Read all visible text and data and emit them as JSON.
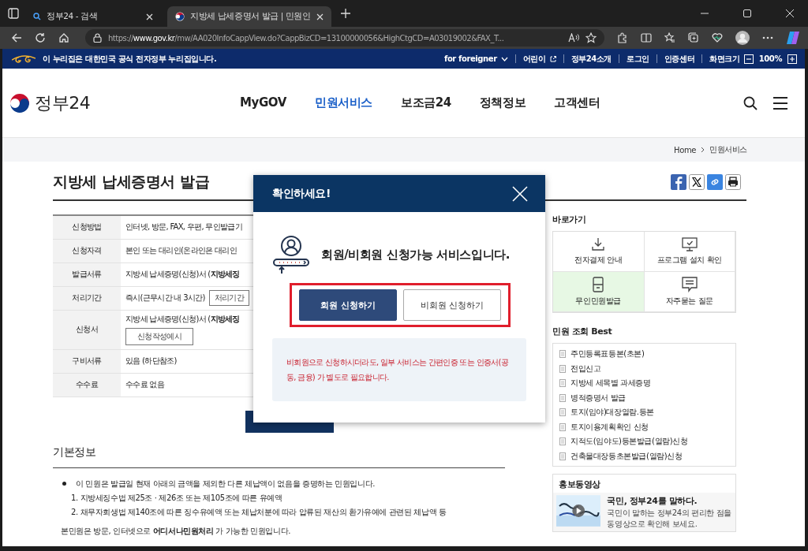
{
  "browser": {
    "tabs": [
      {
        "title": "정부24 - 검색",
        "selected": false
      },
      {
        "title": "지방세 납세증명서 발급 | 민원인",
        "selected": true
      }
    ],
    "url": "https://**www.gov.kr**/mw/AA020InfoCappView.do?CappBizCD=13100000056&HighCtgCD=A03019002&FAX_T..."
  },
  "banner": {
    "notice": "이 누리집은 대한민국 공식 전자정부 누리집입니다.",
    "links": [
      {
        "label": "for foreigner",
        "kind": "dropdown"
      },
      {
        "label": "어린이",
        "kind": "external"
      },
      {
        "label": "정부24소개",
        "kind": "plain"
      },
      {
        "label": "로그인",
        "kind": "plain"
      },
      {
        "label": "인증센터",
        "kind": "plain"
      }
    ],
    "zoom_label": "화면크기",
    "zoom_value": "100%"
  },
  "header": {
    "logo": "정부24",
    "nav": [
      {
        "label": "MyGOV",
        "selected": false
      },
      {
        "label": "민원서비스",
        "selected": true
      },
      {
        "label": "보조금24",
        "selected": false
      },
      {
        "label": "정책정보",
        "selected": false
      },
      {
        "label": "고객센터",
        "selected": false
      }
    ]
  },
  "breadcrumb": [
    "Home",
    "민원서비스"
  ],
  "page": {
    "title": "지방세 납세증명서 발급",
    "rows": [
      {
        "label": "신청방법",
        "value": "인터넷, 방문, FAX, 우편, 무인발급기"
      },
      {
        "label": "신청자격",
        "value": "본인 또는 대리인(온라인은 대리인"
      },
      {
        "label": "발급서류",
        "value": "지방세 납세증명(신청)서 (**지방세징**"
      },
      {
        "label": "처리기간",
        "value": "즉시(근무시간 내 3시간)",
        "button": "처리기간"
      },
      {
        "label": "신청서",
        "value": "지방세 납세증명(신청)서 (**지방세징**",
        "button": "신청작성예시",
        "button_below": true
      },
      {
        "label": "구비서류",
        "value": "있음 (하단참조)"
      },
      {
        "label": "수수료",
        "value": "수수료 없음"
      }
    ]
  },
  "basic_info": {
    "heading": "기본정보",
    "bullet": "이 민원은 발급일 현재 아래의 금액을 제외한 다른 체납액이 없음을 증명하는 민원입니다.",
    "items": [
      "1. 지방세징수법 제25조 · 제26조 또는 제105조에 따른 유예액",
      "2. 채무자회생법 제140조에 따른 징수유예액 또는 체납처분에 따라 압류된 재산의 환가유예에 관련된 체납액 등"
    ],
    "note": "본민원은 방문, 인터넷으로 **어디서나민원처리** 가 가능한 민원입니다."
  },
  "sidebar": {
    "quick_heading": "바로가기",
    "quick_links": [
      {
        "label": "전자결제 안내",
        "kind": "download",
        "highlighted": false
      },
      {
        "label": "프로그램 설치 확인",
        "kind": "monitor",
        "highlighted": false
      },
      {
        "label": "무인민원발급",
        "kind": "kiosk",
        "highlighted": true
      },
      {
        "label": "자주묻는 질문",
        "kind": "chat",
        "highlighted": false
      }
    ],
    "best_heading": "민원 조회 Best",
    "best": [
      "주민등록표등본(초본)",
      "전입신고",
      "지방세 세목별 과세증명",
      "병적증명서 발급",
      "토지(임야)대장열람.등본",
      "토지이용계획확인 신청",
      "지적도(임야도)등본발급(열람)신청",
      "건축물대장등초본발급(열람)신청"
    ],
    "video": {
      "heading": "홍보동영상",
      "title": "국민, 정부24를 말하다.",
      "desc": "국민이 말하는 정부24의 편리한 점을 동영상으로 확인해 보세요."
    }
  },
  "modal": {
    "title": "확인하세요!",
    "message": "회원/비회원 신청가능 서비스입니다.",
    "buttons": [
      {
        "label": "회원 신청하기",
        "primary": true
      },
      {
        "label": "비회원 신청하기",
        "primary": false
      }
    ],
    "notice": "비회원으로 신청하시더라도, 일부 서비스는 간편인증 또는 인증서(공동, 금융) 가 별도로 필요합니다."
  }
}
